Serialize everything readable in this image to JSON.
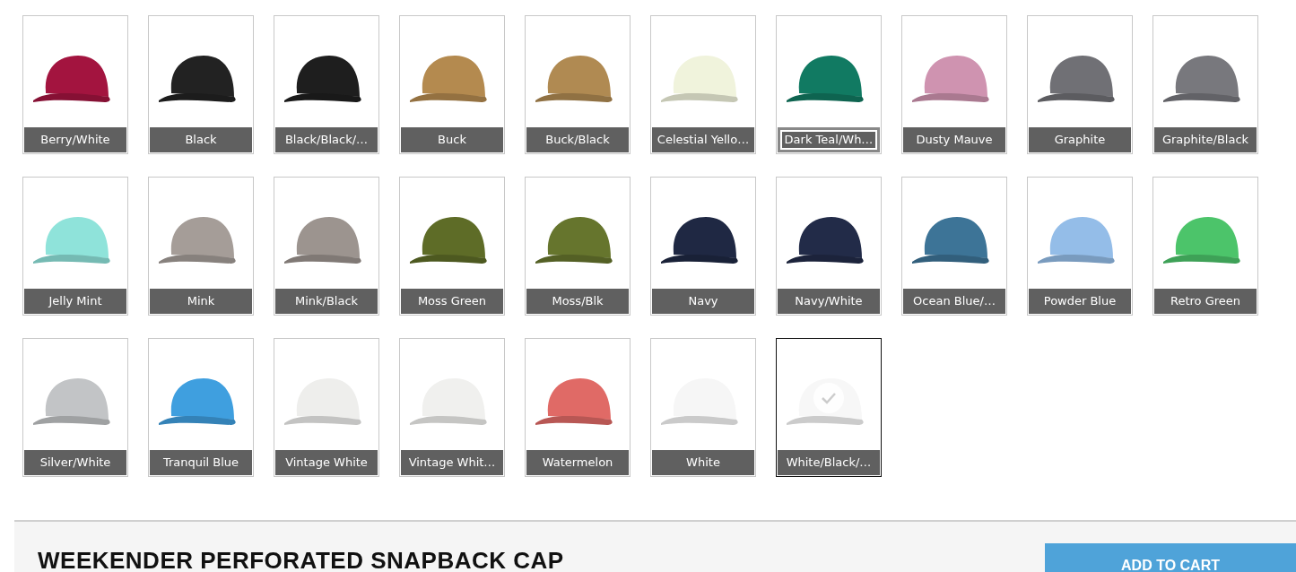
{
  "swatch_rows": [
    {
      "swatches": [
        {
          "label": "Berry/White",
          "color": "#a3143f",
          "selected": false,
          "focused": false
        },
        {
          "label": "Black",
          "color": "#222222",
          "selected": false,
          "focused": false
        },
        {
          "label": "Black/Black/…",
          "color": "#1e1e1e",
          "selected": false,
          "focused": false
        },
        {
          "label": "Buck",
          "color": "#b48a4f",
          "selected": false,
          "focused": false
        },
        {
          "label": "Buck/Black",
          "color": "#b08a52",
          "selected": false,
          "focused": false
        },
        {
          "label": "Celestial Yello…",
          "color": "#f0f3dc",
          "selected": false,
          "focused": false
        },
        {
          "label": "Dark Teal/Wh…",
          "color": "#117a62",
          "selected": false,
          "focused": true
        },
        {
          "label": "Dusty Mauve",
          "color": "#cf93b0",
          "selected": false,
          "focused": false
        },
        {
          "label": "Graphite",
          "color": "#707075",
          "selected": false,
          "focused": false
        },
        {
          "label": "Graphite/Black",
          "color": "#78787d",
          "selected": false,
          "focused": false
        }
      ]
    },
    {
      "swatches": [
        {
          "label": "Jelly Mint",
          "color": "#8fe3da",
          "selected": false,
          "focused": false
        },
        {
          "label": "Mink",
          "color": "#a59d98",
          "selected": false,
          "focused": false
        },
        {
          "label": "Mink/Black",
          "color": "#9c948f",
          "selected": false,
          "focused": false
        },
        {
          "label": "Moss Green",
          "color": "#5e6c27",
          "selected": false,
          "focused": false
        },
        {
          "label": "Moss/Blk",
          "color": "#66752d",
          "selected": false,
          "focused": false
        },
        {
          "label": "Navy",
          "color": "#1f2843",
          "selected": false,
          "focused": false
        },
        {
          "label": "Navy/White",
          "color": "#222b48",
          "selected": false,
          "focused": false
        },
        {
          "label": "Ocean Blue/…",
          "color": "#3d7497",
          "selected": false,
          "focused": false
        },
        {
          "label": "Powder Blue",
          "color": "#94bde8",
          "selected": false,
          "focused": false
        },
        {
          "label": "Retro Green",
          "color": "#4cc46a",
          "selected": false,
          "focused": false
        }
      ]
    },
    {
      "swatches": [
        {
          "label": "Silver/White",
          "color": "#c2c4c6",
          "selected": false,
          "focused": false
        },
        {
          "label": "Tranquil Blue",
          "color": "#3f9fdf",
          "selected": false,
          "focused": false
        },
        {
          "label": "Vintage White",
          "color": "#eeeeec",
          "selected": false,
          "focused": false
        },
        {
          "label": "Vintage Whit…",
          "color": "#f0f0ee",
          "selected": false,
          "focused": false
        },
        {
          "label": "Watermelon",
          "color": "#e06a66",
          "selected": false,
          "focused": false
        },
        {
          "label": "White",
          "color": "#f6f6f6",
          "selected": false,
          "focused": false
        },
        {
          "label": "White/Black/…",
          "color": "#f7f7f7",
          "selected": true,
          "focused": false
        }
      ]
    }
  ],
  "product": {
    "title": "WEEKENDER PERFORATED SNAPBACK CAP",
    "button": "ADD TO CART"
  }
}
